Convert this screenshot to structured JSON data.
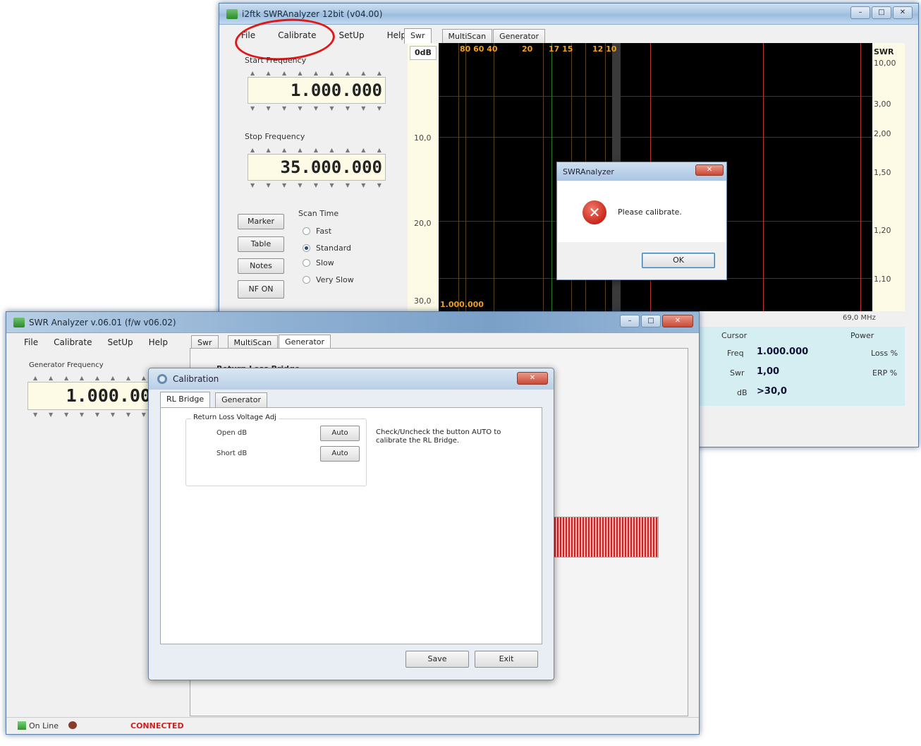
{
  "back_window": {
    "title": "i2ftk SWRAnalyzer 12bit (v04.00)",
    "menu": [
      "File",
      "Calibrate",
      "SetUp",
      "Help"
    ],
    "start_freq_label": "Start Frequency",
    "start_freq": "1.000.000",
    "stop_freq_label": "Stop Frequency",
    "stop_freq": "35.000.000",
    "buttons": [
      "Marker",
      "Table",
      "Notes",
      "NF ON"
    ],
    "scan_time_label": "Scan Time",
    "scan_options": [
      "Fast",
      "Standard",
      "Slow",
      "Very Slow"
    ],
    "scan_selected": "Standard",
    "tabs": [
      "Swr",
      "MultiScan",
      "Generator"
    ],
    "plot": {
      "left_header": "0dB",
      "left_ticks": [
        "10,0",
        "20,0",
        "30,0"
      ],
      "right_header": "SWR",
      "right_ticks": [
        "10,00",
        "3,00",
        "2,00",
        "1,50",
        "1,20",
        "1,10"
      ],
      "band_labels": [
        "80 60 40",
        "20",
        "17 15",
        "12 10"
      ],
      "start_label": "1.000.000",
      "end_label": "69,0 MHz"
    },
    "cursor": {
      "title": "Cursor",
      "freq_label": "Freq",
      "freq": "1.000.000",
      "swr_label": "Swr",
      "swr": "1,00",
      "db_label": "dB",
      "db": ">30,0"
    },
    "power": {
      "title": "Power",
      "loss": "Loss %",
      "erp": "ERP %"
    }
  },
  "alert": {
    "title": "SWRAnalyzer",
    "message": "Please calibrate.",
    "ok": "OK"
  },
  "front_window": {
    "title": "SWR Analyzer v.06.01 (f/w v06.02)",
    "menu": [
      "File",
      "Calibrate",
      "SetUp",
      "Help"
    ],
    "gen_freq_label": "Generator Frequency",
    "gen_freq": "1.000.00",
    "tabs": [
      "Swr",
      "MultiScan",
      "Generator"
    ],
    "hidden_heading": "Return Loss Bridge",
    "status_online": "On Line",
    "status_connected": "CONNECTED"
  },
  "calibration": {
    "title": "Calibration",
    "tabs": [
      "RL Bridge",
      "Generator"
    ],
    "group_title": "Return Loss Voltage Adj",
    "open_label": "Open dB",
    "short_label": "Short dB",
    "auto": "Auto",
    "help_text": "Check/Uncheck the button AUTO to calibrate the RL Bridge.",
    "save": "Save",
    "exit": "Exit"
  },
  "colors": {
    "accent_red": "#e01818",
    "plot_bg": "#000000",
    "band_label": "#f0a020",
    "panel_cyan": "#d4eef2"
  }
}
